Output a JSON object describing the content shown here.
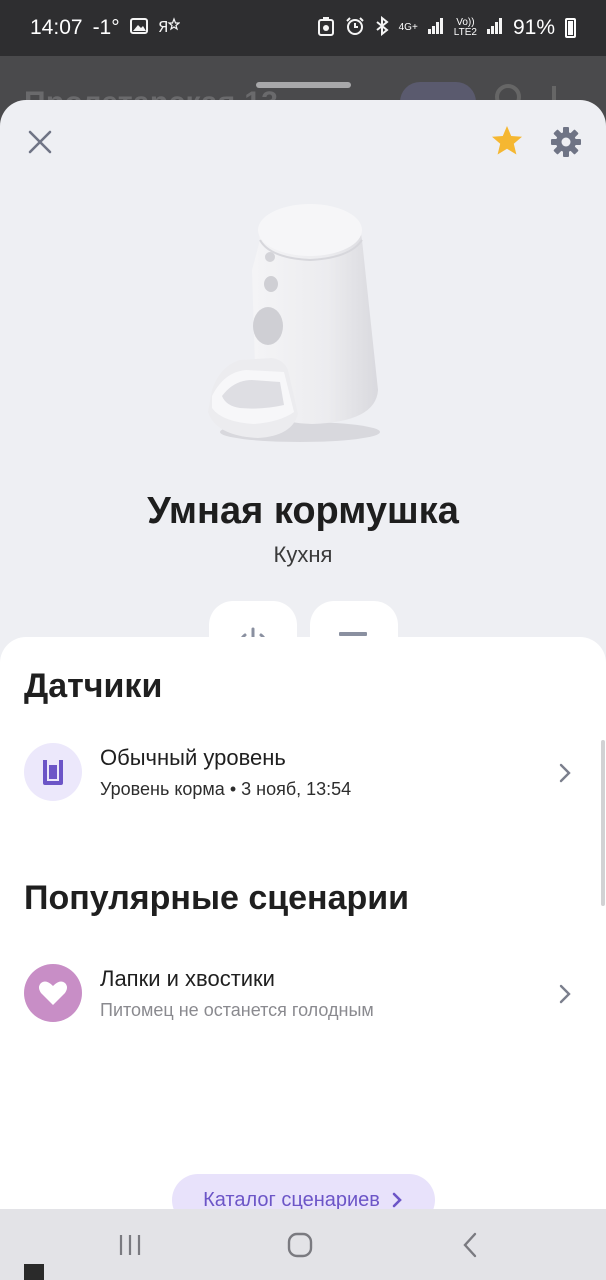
{
  "status_bar": {
    "time": "14:07",
    "temperature": "-1°",
    "network_top": "4G+",
    "volte_top": "Vo))",
    "volte_bottom": "LTE2",
    "battery": "91%"
  },
  "background": {
    "title": "Пролетарская 13"
  },
  "device": {
    "name": "Умная кормушка",
    "room": "Кухня"
  },
  "icons": {
    "close": "close-icon",
    "favorite": "star-icon",
    "settings": "gear-icon",
    "power": "power-icon",
    "scenario": "scenario-play-icon",
    "sensor": "food-level-icon",
    "scenario_row": "heart-icon",
    "chevron": "chevron-right-icon"
  },
  "colors": {
    "star": "#f5b731",
    "accent_purple": "#6c55c7",
    "sensor_icon_bg": "#ece8fb",
    "heart_bg": "#c88ec6"
  },
  "sensors": {
    "title": "Датчики",
    "items": [
      {
        "title": "Обычный уровень",
        "subtitle": "Уровень корма • 3 нояб, 13:54"
      }
    ]
  },
  "scenarios": {
    "title": "Популярные сценарии",
    "items": [
      {
        "title": "Лапки и хвостики",
        "subtitle": "Питомец не останется голодным"
      }
    ],
    "catalog_label": "Каталог сценариев"
  }
}
